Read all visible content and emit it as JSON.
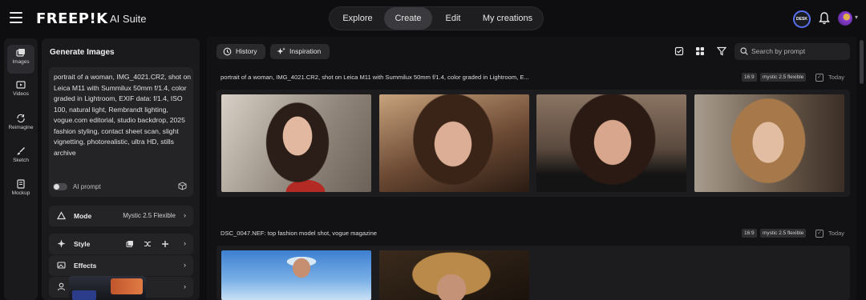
{
  "header": {
    "logo": "FREEP!K",
    "suite": "AI Suite",
    "nav": [
      {
        "label": "Explore",
        "active": false
      },
      {
        "label": "Create",
        "active": true
      },
      {
        "label": "Edit",
        "active": false
      },
      {
        "label": "My creations",
        "active": false
      }
    ],
    "badge": "DESK",
    "icons": [
      "menu-icon",
      "bell-icon",
      "user-avatar",
      "chevron-down-icon"
    ]
  },
  "rail": {
    "items": [
      {
        "label": "Images",
        "icon": "image-icon",
        "active": true
      },
      {
        "label": "Videos",
        "icon": "video-icon",
        "active": false
      },
      {
        "label": "Reimagine",
        "icon": "reimagine-icon",
        "active": false
      },
      {
        "label": "Sketch",
        "icon": "brush-icon",
        "active": false
      },
      {
        "label": "Mockup",
        "icon": "mockup-icon",
        "active": false
      }
    ]
  },
  "panel": {
    "title": "Generate Images",
    "prompt": "portrait of a woman, IMG_4021.CR2, shot on Leica M11 with Summilux 50mm f/1.4, color graded in Lightroom, EXIF data: f/1.4, ISO 100, natural light, Rembrandt lighting, vogue.com editorial, studio backdrop, 2025 fashion styling, contact sheet scan, slight vignetting, photorealistic, ultra HD, stills archive",
    "ai_prompt_label": "AI prompt",
    "mode_label": "Mode",
    "mode_value": "Mystic 2.5 Flexible",
    "style_label": "Style",
    "effects_label": "Effects"
  },
  "toolbar": {
    "history_label": "History",
    "inspiration_label": "Inspiration",
    "search_placeholder": "Search by prompt"
  },
  "groups": [
    {
      "prompt": "portrait of a woman, IMG_4021.CR2, shot on Leica M11 with Summilux 50mm f/1.4, color graded in Lightroom, E...",
      "ratio": "16:9",
      "model": "mystic 2.5 flexible",
      "date": "Today"
    },
    {
      "prompt": "DSC_0047.NEF: top fashion model shot, vogue magazine",
      "ratio": "16:9",
      "model": "mystic 2.5 flexible",
      "date": "Today"
    }
  ]
}
